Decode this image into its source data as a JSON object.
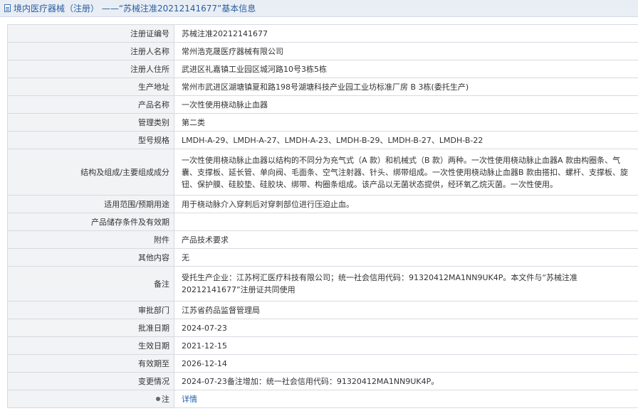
{
  "header": {
    "title": "境内医疗器械（注册） ——“苏械注准20212141677”基本信息"
  },
  "rows": [
    {
      "label": "注册证编号",
      "value": "苏械注准20212141677"
    },
    {
      "label": "注册人名称",
      "value": "常州浩克晟医疗器械有限公司"
    },
    {
      "label": "注册人住所",
      "value": "武进区礼嘉镇工业园区城河路10号3栋5栋"
    },
    {
      "label": "生产地址",
      "value": "常州市武进区湖塘镇夏和路198号湖塘科技产业园工业坊标准厂房 B 3栋(委托生产)"
    },
    {
      "label": "产品名称",
      "value": "一次性使用桡动脉止血器"
    },
    {
      "label": "管理类别",
      "value": "第二类"
    },
    {
      "label": "型号规格",
      "value": "LMDH-A-29、LMDH-A-27、LMDH-A-23、LMDH-B-29、LMDH-B-27、LMDH-B-22"
    },
    {
      "label": "结构及组成/主要组成成分",
      "value": "一次性使用桡动脉止血器以结构的不同分为充气式（A 款）和机械式（B 款）两种。一次性使用桡动脉止血器A 款由构圈条、气囊、支撑板、延长管、单向阀、毛面条、空气注射器、针头、绑带组成。一次性使用桡动脉止血器B 款由搭扣、螺杆、支撑板、旋钮、保护膜、硅胶垫、硅胶块、绑带、构圈条组成。该产品以无菌状态提供，经环氧乙烷灭菌。一次性使用。"
    },
    {
      "label": "适用范围/预期用途",
      "value": "用于桡动脉介入穿刺后对穿刺部位进行压迫止血。"
    },
    {
      "label": "产品储存条件及有效期",
      "value": ""
    },
    {
      "label": "附件",
      "value": "产品技术要求"
    },
    {
      "label": "其他内容",
      "value": "无"
    },
    {
      "label": "备注",
      "value": "受托生产企业：江苏柯汇医疗科技有限公司；统一社会信用代码：91320412MA1NN9UK4P。本文件与“苏械注准20212141677”注册证共同使用"
    },
    {
      "label": "审批部门",
      "value": "江苏省药品监督管理局"
    },
    {
      "label": "批准日期",
      "value": "2024-07-23"
    },
    {
      "label": "生效日期",
      "value": "2021-12-15"
    },
    {
      "label": "有效期至",
      "value": "2026-12-14"
    },
    {
      "label": "变更情况",
      "value": "2024-07-23备注增加：统一社会信用代码：91320412MA1NN9UK4P。"
    },
    {
      "label": "注",
      "value": "详情"
    }
  ],
  "icons": {
    "header": "document-icon",
    "note": "note-icon"
  },
  "colors": {
    "header_bg": "#e9eef5",
    "header_text": "#2a5d9f",
    "label_bg": "#f1f3f5",
    "border": "#d6dbe1",
    "link": "#1e5fb3"
  }
}
